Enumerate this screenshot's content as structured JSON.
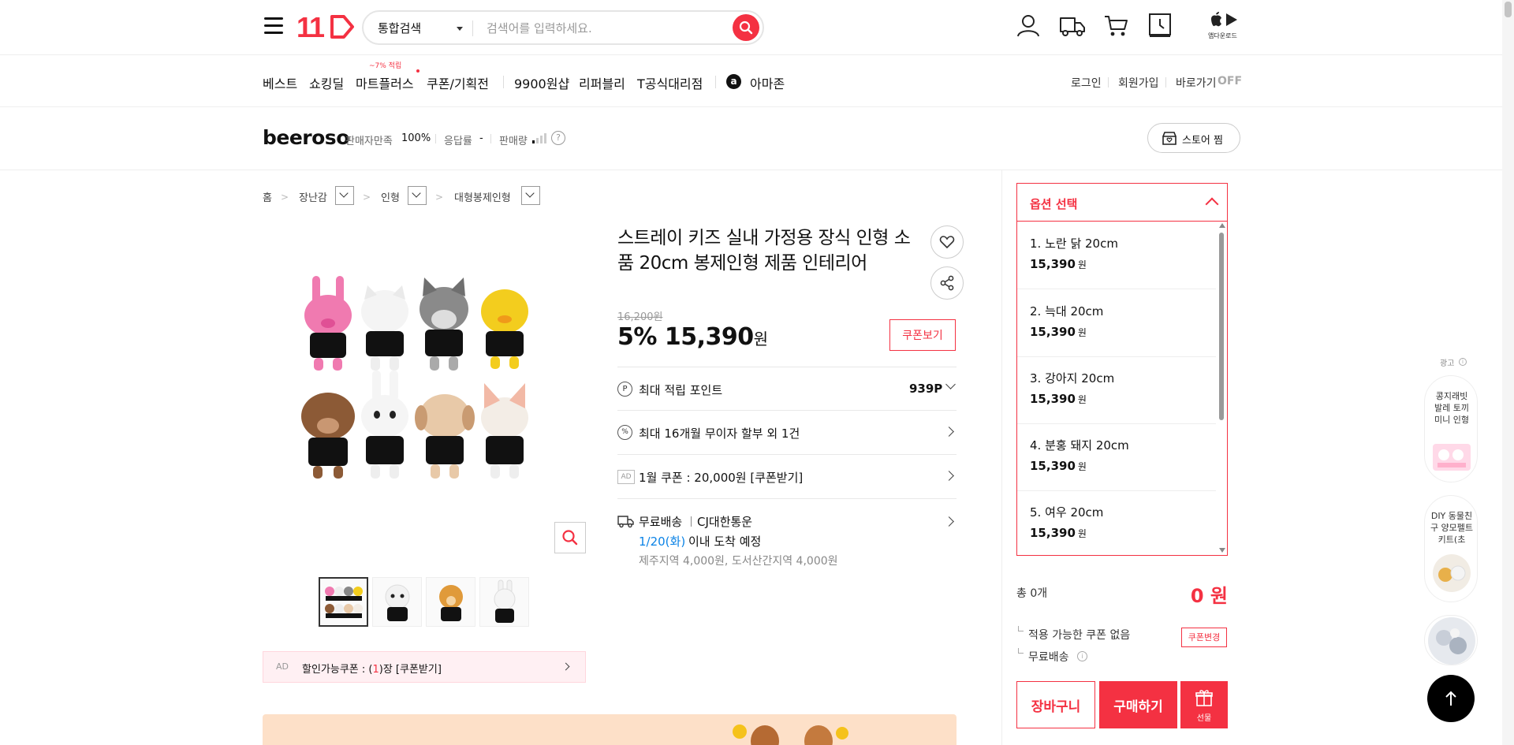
{
  "header": {
    "logo": "11",
    "search_category": "통합검색",
    "search_placeholder": "검색어를 입력하세요.",
    "app_download": "앱다운로드"
  },
  "nav": {
    "items": [
      "베스트",
      "쇼킹딜",
      "마트플러스",
      "쿠폰/기획전",
      "9900원샵",
      "리퍼블리",
      "T공식대리점",
      "아마존"
    ],
    "mart_badge": "~7% 적립",
    "right": [
      "로그인",
      "회원가입",
      "바로가기"
    ],
    "shortcut_state": "OFF"
  },
  "seller": {
    "name": "beeroso",
    "satisfaction_label": "판매자만족",
    "satisfaction_value": "100%",
    "response_label": "응답률",
    "response_value": "-",
    "sales_label": "판매량",
    "store_button": "스토어 찜"
  },
  "breadcrumb": [
    "홈",
    "장난감",
    "인형",
    "대형봉제인형"
  ],
  "product": {
    "title": "스트레이 키즈 실내 가정용 장식 인형 소품 20cm 봉제인형 제품 인테리어",
    "original_price": "16,200원",
    "discount": "5%",
    "price": "15,390",
    "price_unit": "원",
    "coupon_button": "쿠폰보기",
    "point_label": "최대 적립 포인트",
    "point_value": "939P",
    "installment": "최대 16개월 무이자 할부 외 1건",
    "ad_tag": "AD",
    "coupon_offer": "1월 쿠폰 : 20,000원 [쿠폰받기]",
    "shipping_free": "무료배송",
    "carrier": "CJ대한통운",
    "arrival_date": "1/20(화)",
    "arrival_suffix": "이내 도착 예정",
    "extra_fee": "제주지역 4,000원, 도서산간지역 4,000원",
    "discount_coupon_ad": "AD",
    "discount_coupon_prefix": "할인가능쿠폰 : (",
    "discount_coupon_count": "1",
    "discount_coupon_suffix": ")장 [쿠폰받기]"
  },
  "options": {
    "header": "옵션 선택",
    "items": [
      {
        "name": "1. 노란 닭 20cm",
        "price": "15,390",
        "unit": "원"
      },
      {
        "name": "2. 늑대 20cm",
        "price": "15,390",
        "unit": "원"
      },
      {
        "name": "3. 강아지 20cm",
        "price": "15,390",
        "unit": "원"
      },
      {
        "name": "4. 분홍 돼지 20cm",
        "price": "15,390",
        "unit": "원"
      },
      {
        "name": "5. 여우 20cm",
        "price": "15,390",
        "unit": "원"
      }
    ]
  },
  "order": {
    "total_label": "총 0개",
    "total_price": "0 원",
    "no_coupon": "적용 가능한 쿠폰 없음",
    "coupon_change": "쿠폰변경",
    "free_shipping": "무료배송",
    "cart_button": "장바구니",
    "buy_button": "구매하기",
    "gift_button": "선물"
  },
  "ads": {
    "label": "광고",
    "card1": "콩지래빗 발레 토끼 미니 인형",
    "card2": "DIY 동물친구 양모펠트 키트(초"
  },
  "colors": {
    "brand": "#f43142",
    "link_blue": "#0b83e6"
  }
}
